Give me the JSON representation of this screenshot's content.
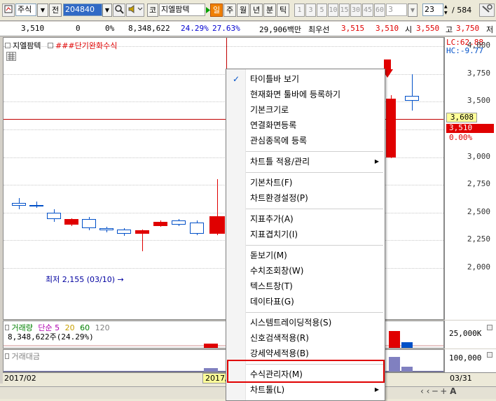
{
  "toolbar": {
    "market_label": "주식",
    "market_dropdown_arrow": "▼",
    "prev_label": "전",
    "code_value": "204840",
    "code_label": "코",
    "stock_name": "지엘팜텍",
    "period_buttons": [
      "일",
      "주",
      "월",
      "년",
      "분",
      "틱"
    ],
    "number_buttons": [
      "1",
      "3",
      "5",
      "10",
      "15",
      "30",
      "45",
      "60"
    ],
    "custom_period_value": "3",
    "count_value": "23",
    "total_label": "/ 584"
  },
  "quote": {
    "price": "3,510",
    "change": "0",
    "change_rate": "0%",
    "volume": "8,348,622",
    "volume_rate": "24.29%",
    "turnover_rate": "27.63%",
    "amount": "29,906백만",
    "best_label": "최우선",
    "best_ask": "3,515",
    "best_bid": "3,510",
    "open_label": "시",
    "open_value": "3,550",
    "high_label": "고",
    "high_value": "3,750",
    "high_suffix": "저"
  },
  "chart": {
    "stock_tag": "지엘팜텍",
    "indicator_tag": "###단기완화수식",
    "lc_label": "LC:62.88",
    "hc_label": "HC:-9.77",
    "low_annotation": "최저 2,155 (03/10)",
    "current_price_tag": "3,608",
    "last_price_tag": "3,510",
    "last_change_tag": "0.00%",
    "y_ticks": [
      "4,000",
      "3,750",
      "3,500",
      "3,250",
      "3,000",
      "2,750",
      "2,500",
      "2,250",
      "2,000"
    ],
    "colors": {
      "up": "#e00000",
      "down": "#0050c8"
    }
  },
  "chart_data": {
    "type": "candlestick",
    "ylim": [
      1850,
      4150
    ],
    "candles": [
      {
        "o": 2590,
        "c": 2560,
        "h": 2630,
        "l": 2530
      },
      {
        "o": 2570,
        "c": 2560,
        "h": 2600,
        "l": 2540
      },
      {
        "o": 2500,
        "c": 2440,
        "h": 2530,
        "l": 2420
      },
      {
        "o": 2390,
        "c": 2440,
        "h": 2450,
        "l": 2380
      },
      {
        "o": 2440,
        "c": 2360,
        "h": 2460,
        "l": 2340
      },
      {
        "o": 2360,
        "c": 2340,
        "h": 2370,
        "l": 2320
      },
      {
        "o": 2350,
        "c": 2310,
        "h": 2360,
        "l": 2290
      },
      {
        "o": 2310,
        "c": 2340,
        "h": 2350,
        "l": 2155
      },
      {
        "o": 2380,
        "c": 2420,
        "h": 2430,
        "l": 2370
      },
      {
        "o": 2430,
        "c": 2390,
        "h": 2440,
        "l": 2380
      },
      {
        "o": 2410,
        "c": 2310,
        "h": 2430,
        "l": 2300
      },
      {
        "o": 2310,
        "c": 2470,
        "h": 2800,
        "l": 2300
      },
      {
        "o": 2480,
        "c": 2420,
        "h": 2500,
        "l": 2410
      },
      {
        "o": 3000,
        "c": 3530,
        "h": 3560,
        "l": 2990
      },
      {
        "o": 3550,
        "c": 3510,
        "h": 3750,
        "l": 3420
      }
    ]
  },
  "volume_pane": {
    "title": "거래량",
    "type_label": "단순",
    "ma_values": [
      "5",
      "20",
      "60",
      "120"
    ],
    "ma_colors": [
      "#b000b0",
      "#c8a000",
      "#008000",
      "#808080"
    ],
    "volume_text": "8,348,622주(24.29%)",
    "axis_label": "25,000K"
  },
  "amount_pane": {
    "title": "거래대금",
    "axis_label": "100,000"
  },
  "x_axis": {
    "start_label": "2017/02",
    "highlight_label": "2017/",
    "end_label": "03/31"
  },
  "menu": {
    "items": [
      {
        "label": "타이틀바 보기",
        "checked": true
      },
      {
        "label": "현재화면 툴바에 등록하기"
      },
      {
        "label": "기본크기로"
      },
      {
        "label": "연결화면등록"
      },
      {
        "label": "관심종목에 등록"
      },
      {
        "label": "차트틀 적용/관리",
        "submenu": true
      },
      {
        "label": "기본차트(F)"
      },
      {
        "label": "차트환경설정(P)"
      },
      {
        "label": "지표추가(A)"
      },
      {
        "label": "지표겹치기(I)"
      },
      {
        "label": "돋보기(M)"
      },
      {
        "label": "수치조회창(W)"
      },
      {
        "label": "텍스트창(T)"
      },
      {
        "label": "데이타표(G)"
      },
      {
        "label": "시스템트레이딩적용(S)"
      },
      {
        "label": "신호검색적용(R)"
      },
      {
        "label": "강세약세적용(B)"
      },
      {
        "label": "수식관리자(M)",
        "highlighted": true
      },
      {
        "label": "차트툴(L)",
        "submenu": true
      }
    ],
    "check_glyph": "✓",
    "submenu_glyph": "▶"
  }
}
